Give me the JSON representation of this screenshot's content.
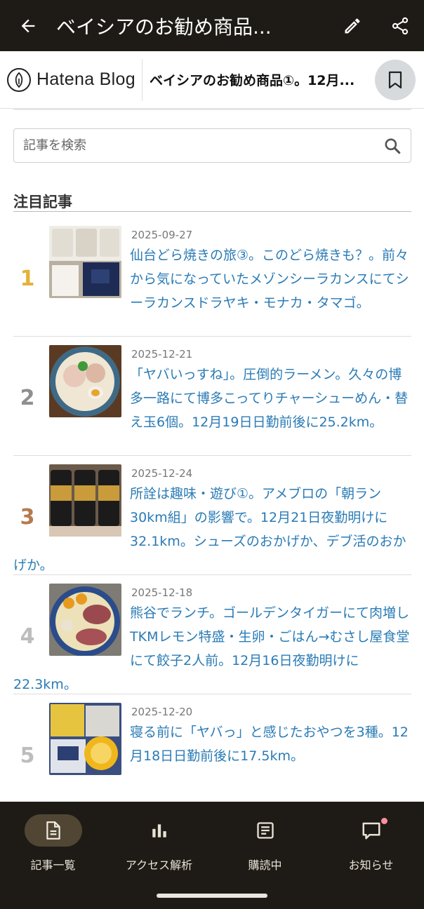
{
  "appbar": {
    "title": "ベイシアのお勧め商品..."
  },
  "blog_header": {
    "logo_text": "Hatena Blog",
    "post_title": "ベイシアのお勧め商品①。12月..."
  },
  "search": {
    "placeholder": "記事を検索"
  },
  "section": {
    "title": "注目記事"
  },
  "articles": [
    {
      "rank": "1",
      "rank_color": "#e3b23c",
      "date": "2025-09-27",
      "title": "仙台どら焼きの旅③。このどら焼きも？。前々から気になっていたメゾンシーラカンスにてシーラカンスドラヤキ・モナカ・タマゴ。"
    },
    {
      "rank": "2",
      "rank_color": "#8f8f8f",
      "date": "2025-12-21",
      "title": "「ヤバいっすね」。圧倒的ラーメン。久々の博多一路にて博多こってりチャーシューめん・替え玉6個。12月19日日勤前後に25.2km。"
    },
    {
      "rank": "3",
      "rank_color": "#b57b4e",
      "date": "2025-12-24",
      "title": "所詮は趣味・遊び①。アメブロの「朝ラン30km組」の影響で。12月21日夜勤明けに32.1km。シューズのおかげか、デブ活のおかげか。"
    },
    {
      "rank": "4",
      "rank_color": "#bdbdbd",
      "date": "2025-12-18",
      "title": "熊谷でランチ。ゴールデンタイガーにて肉増しTKMレモン特盛・生卵・ごはん→むさし屋食堂にて餃子2人前。12月16日夜勤明けに22.3km。"
    },
    {
      "rank": "5",
      "rank_color": "#bdbdbd",
      "date": "2025-12-20",
      "title": "寝る前に「ヤバっ」と感じたおやつを3種。12月18日日勤前後に17.5km。"
    }
  ],
  "bottom_nav": [
    {
      "label": "記事一覧",
      "icon": "document-icon"
    },
    {
      "label": "アクセス解析",
      "icon": "bar-chart-icon"
    },
    {
      "label": "購読中",
      "icon": "reader-icon"
    },
    {
      "label": "お知らせ",
      "icon": "message-icon"
    }
  ],
  "colors": {
    "bar_bg": "#1e1b16",
    "link": "#2a7bb5",
    "active_pill": "#514634"
  }
}
